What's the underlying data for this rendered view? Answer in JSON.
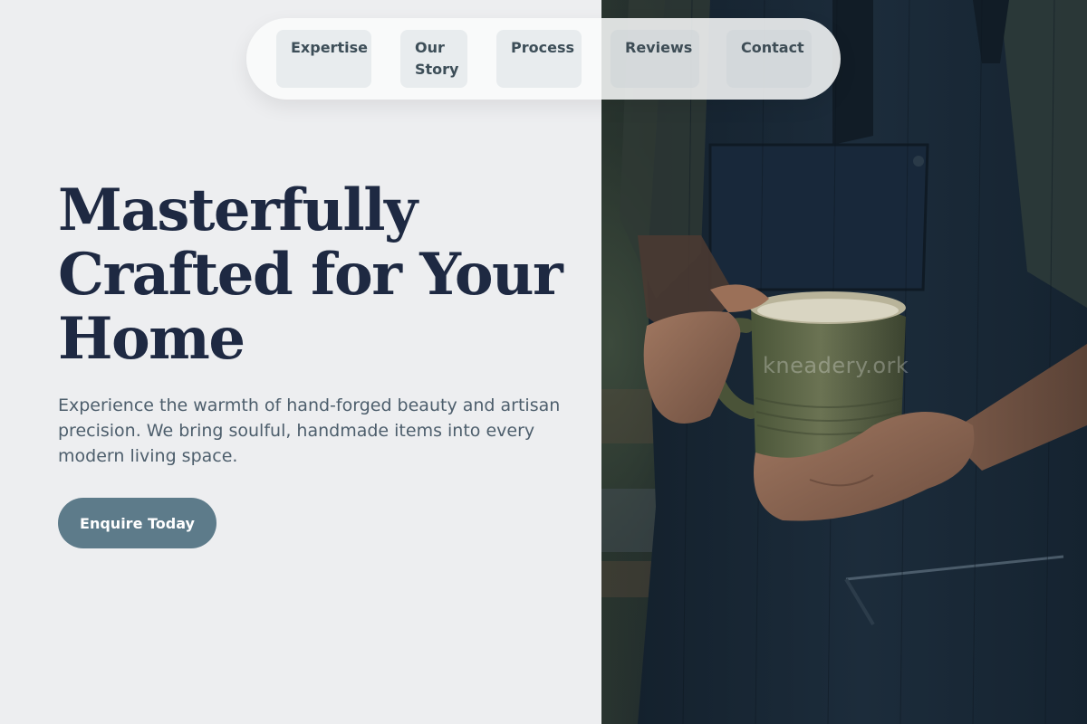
{
  "nav": {
    "items": [
      {
        "label": "Expertise"
      },
      {
        "label": "Our\nStory"
      },
      {
        "label": "Process"
      },
      {
        "label": "Reviews"
      },
      {
        "label": "Contact"
      }
    ]
  },
  "hero": {
    "headline": "Masterfully Crafted for Your Home",
    "subtext": "Experience the warmth of hand-forged beauty and artisan precision. We bring soulful, handmade items into every modern living space.",
    "cta_label": "Enquire Today"
  },
  "image": {
    "watermark": "kneadery.ork",
    "subject": "artisan-holding-ceramic-mug",
    "colors": {
      "apron": "#1a2a3a",
      "mug": "#5b6448",
      "skin": "#a67a62"
    }
  },
  "colors": {
    "background": "#edeef0",
    "headline": "#1e2942",
    "body_text": "#4d5e6c",
    "accent": "#5d7b8a"
  }
}
